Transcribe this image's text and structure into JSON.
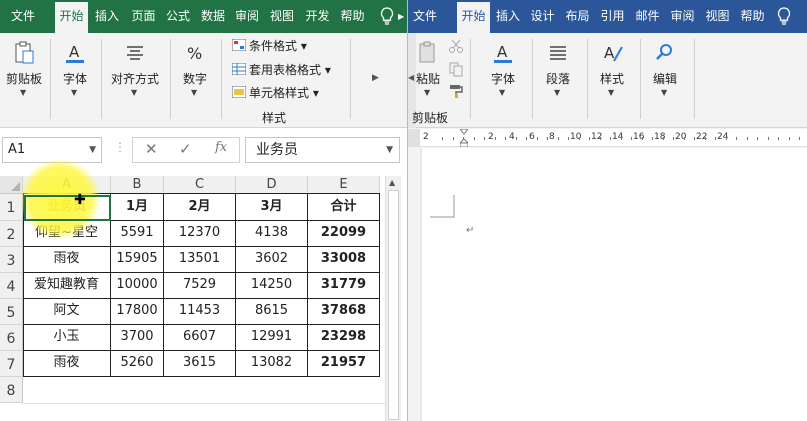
{
  "excel": {
    "tabs": [
      "文件",
      "开始",
      "插入",
      "页面",
      "公式",
      "数据",
      "审阅",
      "视图",
      "开发",
      "帮助"
    ],
    "active_tab": "开始",
    "ribbon": {
      "clipboard": "剪贴板",
      "font": "字体",
      "align": "对齐方式",
      "number": "数字",
      "conditional": "条件格式",
      "table_format": "套用表格格式",
      "cell_style": "单元格样式",
      "styles_group": "样式"
    },
    "name_box": "A1",
    "formula": "业务员",
    "columns": [
      "A",
      "B",
      "C",
      "D",
      "E"
    ],
    "rows": [
      "1",
      "2",
      "3",
      "4",
      "5",
      "6",
      "7",
      "8"
    ],
    "table": [
      [
        "业务员",
        "1月",
        "2月",
        "3月",
        "合计"
      ],
      [
        "仰望~星空",
        "5591",
        "12370",
        "4138",
        "22099"
      ],
      [
        "雨夜",
        "15905",
        "13501",
        "3602",
        "33008"
      ],
      [
        "爱知趣教育",
        "10000",
        "7529",
        "14250",
        "31779"
      ],
      [
        "阿文",
        "17800",
        "11453",
        "8615",
        "37868"
      ],
      [
        "小玉",
        "3700",
        "6607",
        "12991",
        "23298"
      ],
      [
        "雨夜",
        "5260",
        "3615",
        "13082",
        "21957"
      ]
    ],
    "brand_color": "#217346"
  },
  "word": {
    "tabs": [
      "文件",
      "开始",
      "插入",
      "设计",
      "布局",
      "引用",
      "邮件",
      "审阅",
      "视图",
      "帮助"
    ],
    "active_tab": "开始",
    "ribbon": {
      "paste": "粘贴",
      "clipboard_group": "剪贴板",
      "font": "字体",
      "paragraph": "段落",
      "styles": "样式",
      "editing": "编辑"
    },
    "ruler_ticks": [
      "2",
      "2",
      "4",
      "6",
      "8",
      "10",
      "12",
      "14",
      "16",
      "18",
      "20",
      "22",
      "24"
    ],
    "paragraph_mark": "↵",
    "brand_color": "#2b579a"
  }
}
